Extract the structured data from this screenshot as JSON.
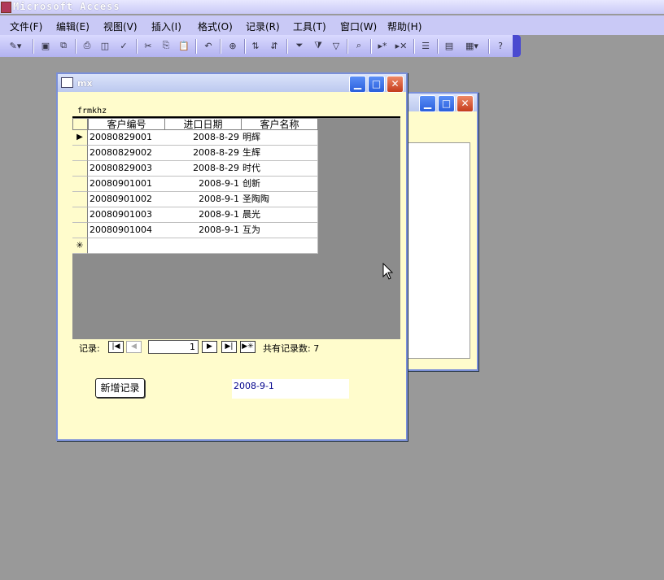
{
  "app": {
    "title": "Microsoft Access"
  },
  "menu": [
    {
      "label": "文件(F)"
    },
    {
      "label": "编辑(E)"
    },
    {
      "label": "视图(V)"
    },
    {
      "label": "插入(I)"
    },
    {
      "label": "格式(O)"
    },
    {
      "label": "记录(R)"
    },
    {
      "label": "工具(T)"
    },
    {
      "label": "窗口(W)"
    },
    {
      "label": "帮助(H)"
    }
  ],
  "toolbar": {
    "icons": [
      "view-icon",
      "save-icon",
      "search-file-icon",
      "print-icon",
      "print-preview-icon",
      "spelling-icon",
      "cut-icon",
      "copy-icon",
      "paste-icon",
      "undo-icon",
      "hyperlink-icon",
      "sort-asc-icon",
      "sort-desc-icon",
      "filter-by-selection-icon",
      "filter-by-form-icon",
      "apply-filter-icon",
      "find-icon",
      "new-record-icon",
      "delete-record-icon",
      "properties-icon",
      "database-window-icon",
      "new-object-icon",
      "help-icon"
    ]
  },
  "form": {
    "window_title": "mx",
    "subform_label": "frmkhz",
    "columns": [
      "客户编号",
      "进口日期",
      "客户名称"
    ],
    "rows": [
      {
        "id": "20080829001",
        "date": "2008-8-29",
        "name": "明辉"
      },
      {
        "id": "20080829002",
        "date": "2008-8-29",
        "name": "生辉"
      },
      {
        "id": "20080829003",
        "date": "2008-8-29",
        "name": "时代"
      },
      {
        "id": "20080901001",
        "date": "2008-9-1",
        "name": "创新"
      },
      {
        "id": "20080901002",
        "date": "2008-9-1",
        "name": "圣陶陶"
      },
      {
        "id": "20080901003",
        "date": "2008-9-1",
        "name": "晨光"
      },
      {
        "id": "20080901004",
        "date": "2008-9-1",
        "name": "互为"
      }
    ],
    "current_row_marker": "▶",
    "new_row_marker": "✳",
    "nav": {
      "label": "记录:",
      "current": "1",
      "total_label": "共有记录数: 7"
    },
    "add_button": "新增记录",
    "date_field": "2008-9-1"
  }
}
